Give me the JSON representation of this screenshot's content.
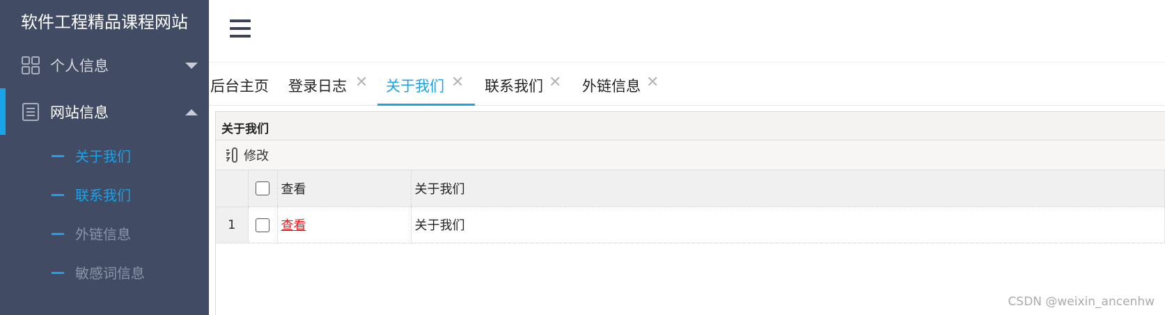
{
  "sidebar": {
    "title": "软件工程精品课程网站",
    "menus": [
      {
        "label": "个人信息",
        "icon": "grid-icon",
        "expanded": false
      },
      {
        "label": "网站信息",
        "icon": "document-icon",
        "expanded": true
      }
    ],
    "submenu": [
      {
        "label": "关于我们",
        "active": true
      },
      {
        "label": "联系我们",
        "active": false
      },
      {
        "label": "外链信息",
        "active": false
      },
      {
        "label": "敏感词信息",
        "active": false
      }
    ]
  },
  "tabs": [
    {
      "label": "后台主页",
      "closable": false
    },
    {
      "label": "登录日志",
      "closable": true
    },
    {
      "label": "关于我们",
      "closable": true,
      "active": true
    },
    {
      "label": "联系我们",
      "closable": true
    },
    {
      "label": "外链信息",
      "closable": true
    }
  ],
  "tab_close_glyph": "✕",
  "panel": {
    "title": "关于我们",
    "toolbar": {
      "edit_label": "修改"
    },
    "columns": {
      "view": "查看",
      "about": "关于我们"
    },
    "rows": [
      {
        "num": "1",
        "view": "查看",
        "about": "关于我们"
      }
    ]
  },
  "watermark": "CSDN @weixin_ancenhw",
  "colors": {
    "sidebar_bg": "#414b63",
    "accent": "#1aa3e8",
    "link_red": "#e8191e"
  }
}
